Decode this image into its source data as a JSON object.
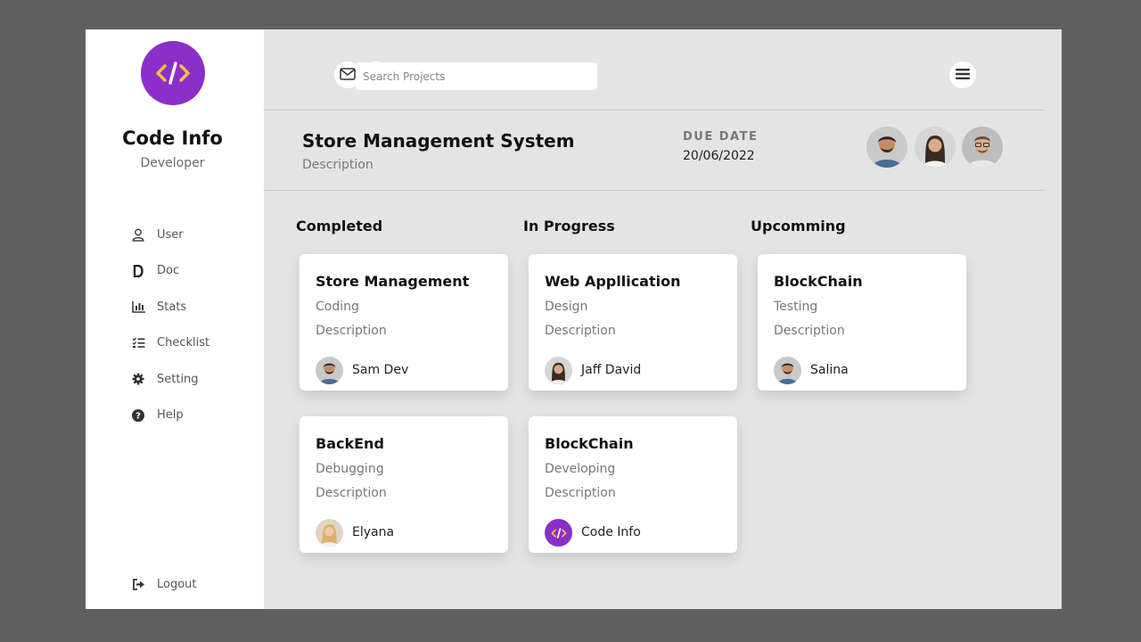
{
  "brand": {
    "name": "Code Info",
    "role": "Developer",
    "logo_icon": "code-icon",
    "color": "#8a2fc9",
    "accent": "#f3c13a"
  },
  "sidebar": {
    "items": [
      {
        "label": "User",
        "icon": "user-icon"
      },
      {
        "label": "Doc",
        "icon": "doc-icon"
      },
      {
        "label": "Stats",
        "icon": "stats-icon"
      },
      {
        "label": "Checklist",
        "icon": "checklist-icon"
      },
      {
        "label": "Setting",
        "icon": "gear-icon"
      },
      {
        "label": "Help",
        "icon": "help-icon"
      }
    ],
    "logout": {
      "label": "Logout",
      "icon": "logout-icon"
    }
  },
  "header": {
    "icons": [
      "mail-icon",
      "bell-icon",
      "menu-icon"
    ],
    "search_placeholder": "Search Projects"
  },
  "project": {
    "title": "Store Management System",
    "description": "Description",
    "due_label": "DUE DATE",
    "due_value": "20/06/2022"
  },
  "columns": [
    {
      "title": "Completed",
      "cards": [
        {
          "title": "Store Management",
          "task": "Coding",
          "description": "Description",
          "user": "Sam Dev"
        },
        {
          "title": "BackEnd",
          "task": "Debugging",
          "description": "Description",
          "user": "Elyana"
        }
      ]
    },
    {
      "title": "In Progress",
      "cards": [
        {
          "title": "Web Appllication",
          "task": "Design",
          "description": "Description",
          "user": "Jaff David"
        },
        {
          "title": "BlockChain",
          "task": "Developing",
          "description": "Description",
          "user": "Code Info"
        }
      ]
    },
    {
      "title": "Upcomming",
      "cards": [
        {
          "title": "BlockChain",
          "task": "Testing",
          "description": "Description",
          "user": "Salina"
        }
      ]
    }
  ]
}
